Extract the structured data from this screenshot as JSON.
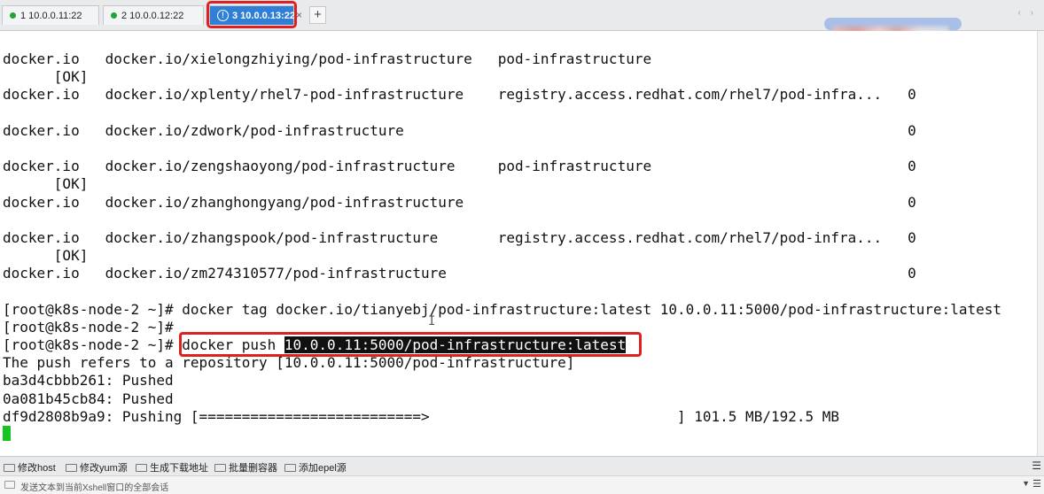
{
  "tabs": [
    {
      "label": "1 10.0.0.11:22",
      "status": "connected"
    },
    {
      "label": "2 10.0.0.12:22",
      "status": "connected"
    },
    {
      "label": "3 10.0.0.13:22",
      "status": "warning"
    }
  ],
  "tab_close_glyph": "×",
  "tab_add_glyph": "+",
  "nav_arrows": "‹ ›",
  "terminal": {
    "lines": [
      "docker.io   docker.io/xielongzhiying/pod-infrastructure   pod-infrastructure",
      "      [OK]",
      "docker.io   docker.io/xplenty/rhel7-pod-infrastructure    registry.access.redhat.com/rhel7/pod-infra...   0",
      "",
      "docker.io   docker.io/zdwork/pod-infrastructure                                                           0",
      "",
      "docker.io   docker.io/zengshaoyong/pod-infrastructure     pod-infrastructure                              0",
      "      [OK]",
      "docker.io   docker.io/zhanghongyang/pod-infrastructure                                                    0",
      "",
      "docker.io   docker.io/zhangspook/pod-infrastructure       registry.access.redhat.com/rhel7/pod-infra...   0",
      "      [OK]",
      "docker.io   docker.io/zm274310577/pod-infrastructure                                                      0",
      "",
      "[root@k8s-node-2 ~]# docker tag docker.io/tianyebj/pod-infrastructure:latest 10.0.0.11:5000/pod-infrastructure:latest",
      "[root@k8s-node-2 ~]#"
    ],
    "push_prompt": "[root@k8s-node-2 ~]# ",
    "push_cmd": "docker push ",
    "push_target": "10.0.0.11:5000/pod-infrastructure:latest",
    "output_lines": [
      "The push refers to a repository [10.0.0.11:5000/pod-infrastructure]",
      "ba3d4cbbb261: Pushed",
      "0a081b45cb84: Pushed",
      "df9d2808b9a9: Pushing [==========================>                             ] 101.5 MB/192.5 MB"
    ]
  },
  "quick_commands": [
    "修改host",
    "修改yum源",
    "生成下载地址",
    "批量删容器",
    "添加epel源"
  ],
  "compose_bar": {
    "placeholder": "发送文本到当前Xshell窗口的全部会话"
  },
  "colors": {
    "active_tab": "#2f7fd6",
    "status_dot": "#22a336",
    "highlight_box": "#e02020",
    "cursor": "#18c41f"
  }
}
